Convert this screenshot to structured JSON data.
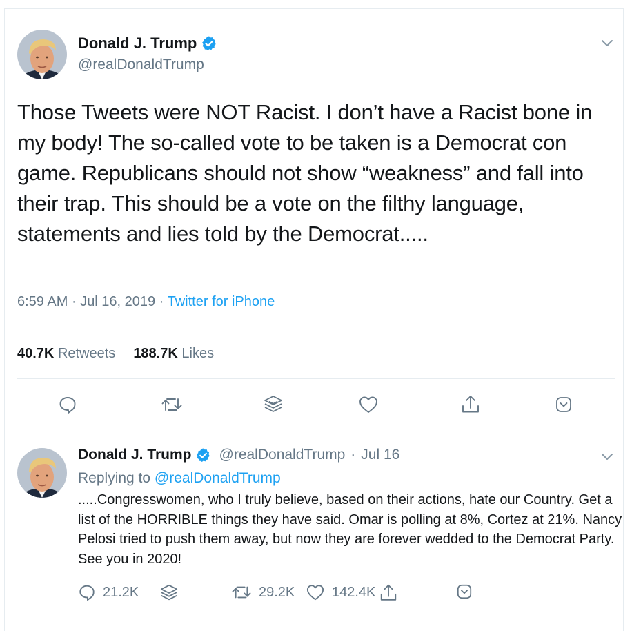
{
  "main_tweet": {
    "author_name": "Donald J. Trump",
    "handle": "@realDonaldTrump",
    "text": "Those Tweets were NOT Racist. I don’t have a Racist bone in my body! The so-called vote to be taken is a Democrat con game. Republicans should not show “weakness” and fall into their trap. This should be a vote on the filthy language, statements and lies told by the Democrat.....",
    "time": "6:59 AM",
    "date": "Jul 16, 2019",
    "separator": "·",
    "source": "Twitter for iPhone",
    "retweets_count": "40.7K",
    "retweets_label": "Retweets",
    "likes_count": "188.7K",
    "likes_label": "Likes",
    "actions": [
      "reply-icon",
      "retweet-icon",
      "stack-icon",
      "like-icon",
      "share-icon",
      "more-icon"
    ]
  },
  "reply_tweet": {
    "author_name": "Donald J. Trump",
    "handle": "@realDonaldTrump",
    "dot": "·",
    "date": "Jul 16",
    "replying_prefix": "Replying to",
    "replying_handle": "@realDonaldTrump",
    "text": ".....Congresswomen, who I truly believe, based on their actions, hate our Country. Get a list of the HORRIBLE things they have said. Omar is polling at 8%, Cortez at 21%. Nancy Pelosi tried to push them away, but now they are forever wedded to the Democrat Party. See you in 2020!",
    "reply_count": "21.2K",
    "retweet_count": "29.2K",
    "like_count": "142.4K"
  },
  "colors": {
    "accent": "#1da1f2",
    "secondary_text": "#657786",
    "primary_text": "#14171a",
    "border": "#e6ecf0"
  }
}
